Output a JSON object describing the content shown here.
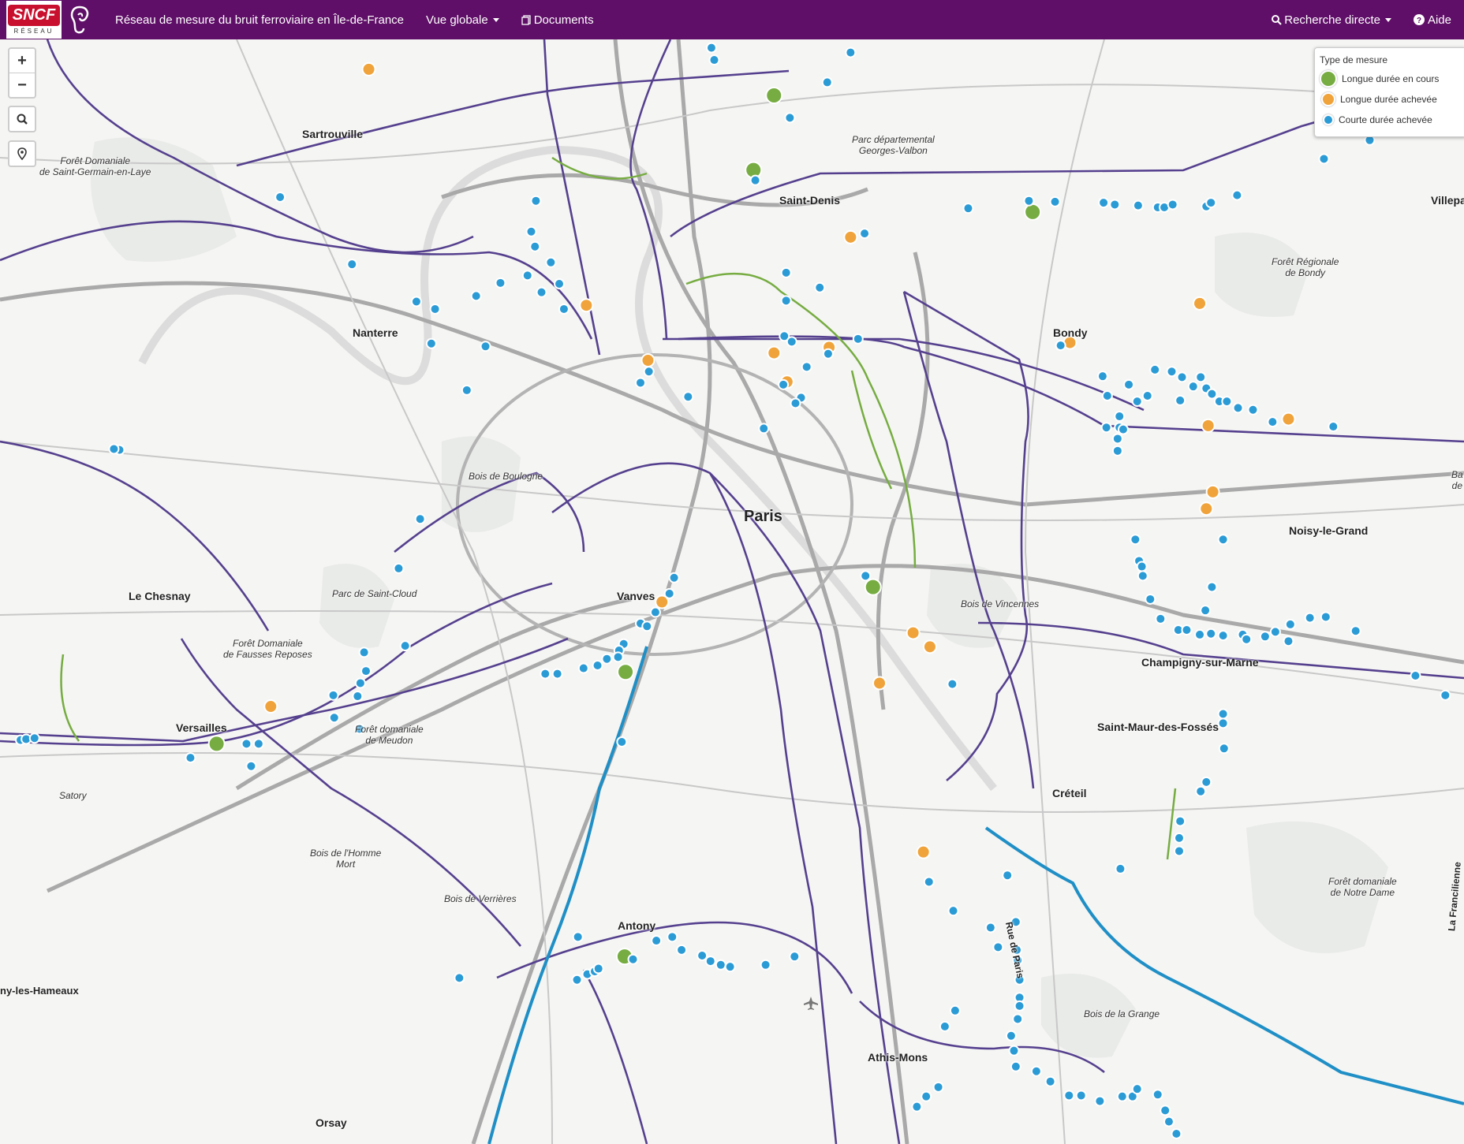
{
  "navbar": {
    "brand": "SNCF",
    "brand_sub": "RÉSEAU",
    "title": "Réseau de mesure du bruit ferroviaire en Île-de-France",
    "vue_globale": "Vue globale",
    "documents": "Documents",
    "recherche": "Recherche directe",
    "aide": "Aide"
  },
  "controls": {
    "zoom_in": "+",
    "zoom_out": "−"
  },
  "legend": {
    "title": "Type de mesure",
    "items": [
      {
        "label": "Longue durée en cours",
        "color": "#76ac41"
      },
      {
        "label": "Longue durée achevée",
        "color": "#f0a33a"
      },
      {
        "label": "Courte durée achevée",
        "color": "#2b9bd6"
      }
    ]
  },
  "places": {
    "sartrouville": "Sartrouville",
    "foret_sgl_1": "Forêt Domaniale",
    "foret_sgl_2": "de Saint-Germain-en-Laye",
    "parc_gv_1": "Parc départemental",
    "parc_gv_2": "Georges-Valbon",
    "saint_denis": "Saint-Denis",
    "villepa": "Villepa",
    "foret_bondy_1": "Forêt Régionale",
    "foret_bondy_2": "de Bondy",
    "nanterre": "Nanterre",
    "bondy": "Bondy",
    "bois_boulogne": "Bois de Boulogne",
    "paris": "Paris",
    "noisy": "Noisy-le-Grand",
    "le_chesnay": "Le Chesnay",
    "parc_st_cloud": "Parc de Saint-Cloud",
    "vanves": "Vanves",
    "bois_vincennes": "Bois de Vincennes",
    "foret_fr_1": "Forêt Domaniale",
    "foret_fr_2": "de Fausses Reposes",
    "champigny": "Champigny-sur-Marne",
    "versailles": "Versailles",
    "foret_meudon_1": "Forêt domaniale",
    "foret_meudon_2": "de Meudon",
    "saint_maur": "Saint-Maur-des-Fossés",
    "satory": "Satory",
    "creteil": "Créteil",
    "bois_hm_1": "Bois de l'Homme",
    "bois_hm_2": "Mort",
    "bois_verrieres": "Bois de Verrières",
    "foret_nd_1": "Forêt domaniale",
    "foret_nd_2": "de Notre Dame",
    "antony": "Antony",
    "rue_paris": "Rue de Paris",
    "hameaux": "ny-les-Hameaux",
    "bois_grange": "Bois de la Grange",
    "athis": "Athis-Mons",
    "orsay": "Orsay",
    "francilienne": "La Francilienne",
    "ba_1": "Ba",
    "ba_2": "de"
  },
  "markers": {
    "green": [
      [
        829,
        102
      ],
      [
        807,
        182
      ],
      [
        1106,
        227
      ],
      [
        935,
        629
      ],
      [
        670,
        720
      ],
      [
        232,
        797
      ],
      [
        669,
        1025
      ]
    ],
    "orange": [
      [
        395,
        74
      ],
      [
        628,
        327
      ],
      [
        694,
        386
      ],
      [
        829,
        378
      ],
      [
        888,
        372
      ],
      [
        843,
        409
      ],
      [
        911,
        254
      ],
      [
        1285,
        325
      ],
      [
        1146,
        367
      ],
      [
        1380,
        449
      ],
      [
        1294,
        456
      ],
      [
        1299,
        527
      ],
      [
        1292,
        545
      ],
      [
        709,
        645
      ],
      [
        978,
        678
      ],
      [
        996,
        693
      ],
      [
        942,
        732
      ],
      [
        290,
        757
      ],
      [
        989,
        913
      ]
    ],
    "blue": [
      [
        762,
        51
      ],
      [
        765,
        64
      ],
      [
        911,
        56
      ],
      [
        886,
        88
      ],
      [
        846,
        126
      ],
      [
        809,
        193
      ],
      [
        300,
        211
      ],
      [
        574,
        215
      ],
      [
        569,
        248
      ],
      [
        573,
        264
      ],
      [
        590,
        281
      ],
      [
        565,
        295
      ],
      [
        599,
        304
      ],
      [
        536,
        303
      ],
      [
        580,
        313
      ],
      [
        510,
        317
      ],
      [
        446,
        323
      ],
      [
        466,
        331
      ],
      [
        604,
        331
      ],
      [
        377,
        283
      ],
      [
        462,
        368
      ],
      [
        520,
        371
      ],
      [
        500,
        418
      ],
      [
        737,
        425
      ],
      [
        695,
        398
      ],
      [
        686,
        410
      ],
      [
        926,
        250
      ],
      [
        842,
        292
      ],
      [
        842,
        322
      ],
      [
        878,
        308
      ],
      [
        840,
        360
      ],
      [
        848,
        366
      ],
      [
        919,
        363
      ],
      [
        887,
        379
      ],
      [
        864,
        393
      ],
      [
        839,
        412
      ],
      [
        858,
        426
      ],
      [
        852,
        432
      ],
      [
        818,
        459
      ],
      [
        1037,
        223
      ],
      [
        1102,
        215
      ],
      [
        1130,
        216
      ],
      [
        1182,
        217
      ],
      [
        1194,
        219
      ],
      [
        1219,
        220
      ],
      [
        1240,
        222
      ],
      [
        1247,
        222
      ],
      [
        1256,
        219
      ],
      [
        1292,
        221
      ],
      [
        1297,
        217
      ],
      [
        1325,
        209
      ],
      [
        1418,
        170
      ],
      [
        1467,
        150
      ],
      [
        1136,
        370
      ],
      [
        1181,
        403
      ],
      [
        1209,
        412
      ],
      [
        1237,
        396
      ],
      [
        1255,
        398
      ],
      [
        1266,
        404
      ],
      [
        1286,
        404
      ],
      [
        1278,
        414
      ],
      [
        1292,
        416
      ],
      [
        1186,
        424
      ],
      [
        1218,
        430
      ],
      [
        1229,
        424
      ],
      [
        1298,
        422
      ],
      [
        1306,
        430
      ],
      [
        1314,
        430
      ],
      [
        1326,
        437
      ],
      [
        1342,
        439
      ],
      [
        1363,
        452
      ],
      [
        1428,
        457
      ],
      [
        1199,
        446
      ],
      [
        1185,
        458
      ],
      [
        1199,
        458
      ],
      [
        1203,
        460
      ],
      [
        1197,
        470
      ],
      [
        1197,
        483
      ],
      [
        1264,
        429
      ],
      [
        1310,
        578
      ],
      [
        1216,
        578
      ],
      [
        1220,
        601
      ],
      [
        1223,
        607
      ],
      [
        1224,
        617
      ],
      [
        1298,
        629
      ],
      [
        1232,
        642
      ],
      [
        1291,
        654
      ],
      [
        1243,
        663
      ],
      [
        1262,
        675
      ],
      [
        1271,
        675
      ],
      [
        1285,
        680
      ],
      [
        1297,
        679
      ],
      [
        1310,
        681
      ],
      [
        1331,
        680
      ],
      [
        1335,
        685
      ],
      [
        1355,
        682
      ],
      [
        1366,
        677
      ],
      [
        1382,
        669
      ],
      [
        1380,
        687
      ],
      [
        1403,
        662
      ],
      [
        1420,
        661
      ],
      [
        1452,
        676
      ],
      [
        1516,
        724
      ],
      [
        1548,
        745
      ],
      [
        1310,
        765
      ],
      [
        1310,
        775
      ],
      [
        1311,
        802
      ],
      [
        1292,
        838
      ],
      [
        1286,
        848
      ],
      [
        1264,
        880
      ],
      [
        1263,
        898
      ],
      [
        1263,
        912
      ],
      [
        1200,
        931
      ],
      [
        128,
        482
      ],
      [
        122,
        481
      ],
      [
        450,
        556
      ],
      [
        427,
        609
      ],
      [
        722,
        619
      ],
      [
        717,
        636
      ],
      [
        702,
        656
      ],
      [
        686,
        668
      ],
      [
        693,
        671
      ],
      [
        668,
        690
      ],
      [
        663,
        697
      ],
      [
        662,
        704
      ],
      [
        650,
        706
      ],
      [
        640,
        713
      ],
      [
        625,
        716
      ],
      [
        597,
        722
      ],
      [
        584,
        722
      ],
      [
        434,
        692
      ],
      [
        390,
        699
      ],
      [
        392,
        719
      ],
      [
        386,
        732
      ],
      [
        357,
        745
      ],
      [
        383,
        746
      ],
      [
        358,
        769
      ],
      [
        385,
        781
      ],
      [
        264,
        797
      ],
      [
        277,
        797
      ],
      [
        269,
        821
      ],
      [
        204,
        812
      ],
      [
        22,
        793
      ],
      [
        28,
        792
      ],
      [
        37,
        791
      ],
      [
        927,
        617
      ],
      [
        1020,
        733
      ],
      [
        666,
        795
      ],
      [
        995,
        945
      ],
      [
        1079,
        938
      ],
      [
        1021,
        976
      ],
      [
        1061,
        994
      ],
      [
        1088,
        988
      ],
      [
        1069,
        1015
      ],
      [
        1089,
        1018
      ],
      [
        1090,
        1029
      ],
      [
        1092,
        1050
      ],
      [
        1092,
        1069
      ],
      [
        1092,
        1078
      ],
      [
        1090,
        1092
      ],
      [
        1083,
        1110
      ],
      [
        1086,
        1126
      ],
      [
        1088,
        1143
      ],
      [
        1110,
        1148
      ],
      [
        1125,
        1159
      ],
      [
        1145,
        1174
      ],
      [
        1158,
        1174
      ],
      [
        1178,
        1180
      ],
      [
        1202,
        1175
      ],
      [
        1213,
        1175
      ],
      [
        1218,
        1167
      ],
      [
        1240,
        1173
      ],
      [
        1248,
        1190
      ],
      [
        1252,
        1202
      ],
      [
        1260,
        1215
      ],
      [
        1023,
        1083
      ],
      [
        1012,
        1100
      ],
      [
        1005,
        1165
      ],
      [
        992,
        1175
      ],
      [
        982,
        1186
      ],
      [
        619,
        1004
      ],
      [
        492,
        1048
      ],
      [
        618,
        1050
      ],
      [
        629,
        1044
      ],
      [
        637,
        1041
      ],
      [
        641,
        1038
      ],
      [
        678,
        1028
      ],
      [
        703,
        1008
      ],
      [
        720,
        1004
      ],
      [
        730,
        1018
      ],
      [
        752,
        1024
      ],
      [
        761,
        1030
      ],
      [
        772,
        1034
      ],
      [
        782,
        1036
      ],
      [
        820,
        1034
      ],
      [
        851,
        1025
      ]
    ]
  }
}
